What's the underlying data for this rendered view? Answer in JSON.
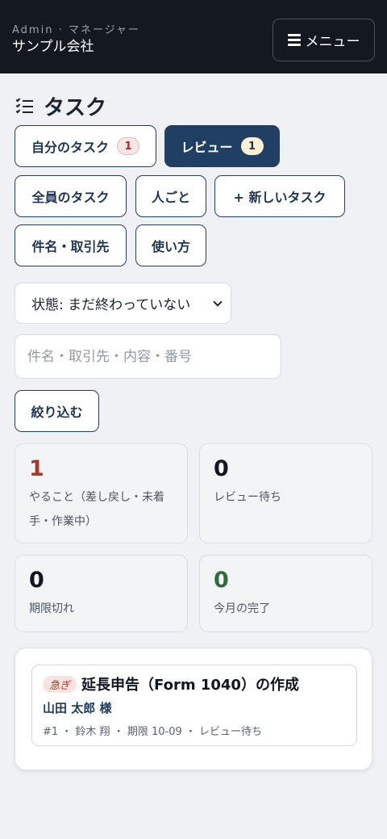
{
  "header": {
    "role": "Admin · マネージャー",
    "company": "サンプル会社",
    "menu_label": "メニュー",
    "menu_icon": "hamburger-icon"
  },
  "page": {
    "title": "タスク",
    "title_icon": "checklist-icon"
  },
  "filters": {
    "my_tasks": {
      "label": "自分のタスク",
      "count": "1"
    },
    "review": {
      "label": "レビュー",
      "count": "1"
    },
    "all_tasks": "全員のタスク",
    "by_person": "人ごと",
    "new_task": "+ 新しいタスク",
    "subject_client": "件名・取引先",
    "how_to": "使い方"
  },
  "status_select": {
    "value": "状態: まだ終わっていない"
  },
  "search": {
    "placeholder": "件名・取引先・内容・番号"
  },
  "narrow_button": "絞り込む",
  "stats": [
    {
      "value": "1",
      "label": "やること（差し戻し・未着手・作業中）"
    },
    {
      "value": "0",
      "label": "レビュー待ち"
    },
    {
      "value": "0",
      "label": "期限切れ"
    },
    {
      "value": "0",
      "label": "今月の完了"
    }
  ],
  "tasks": [
    {
      "tag": "急ぎ",
      "title": "延長申告（Form 1040）の作成",
      "client": "山田 太郎 様",
      "meta": "#1 ・ 鈴木 翔 ・ 期限 10-09 ・ レビュー待ち"
    }
  ],
  "colors": {
    "topbar": "#141821",
    "primary": "#213f62",
    "danger": "#a23d2d",
    "success": "#2e6b40",
    "background": "#eff1f4"
  }
}
